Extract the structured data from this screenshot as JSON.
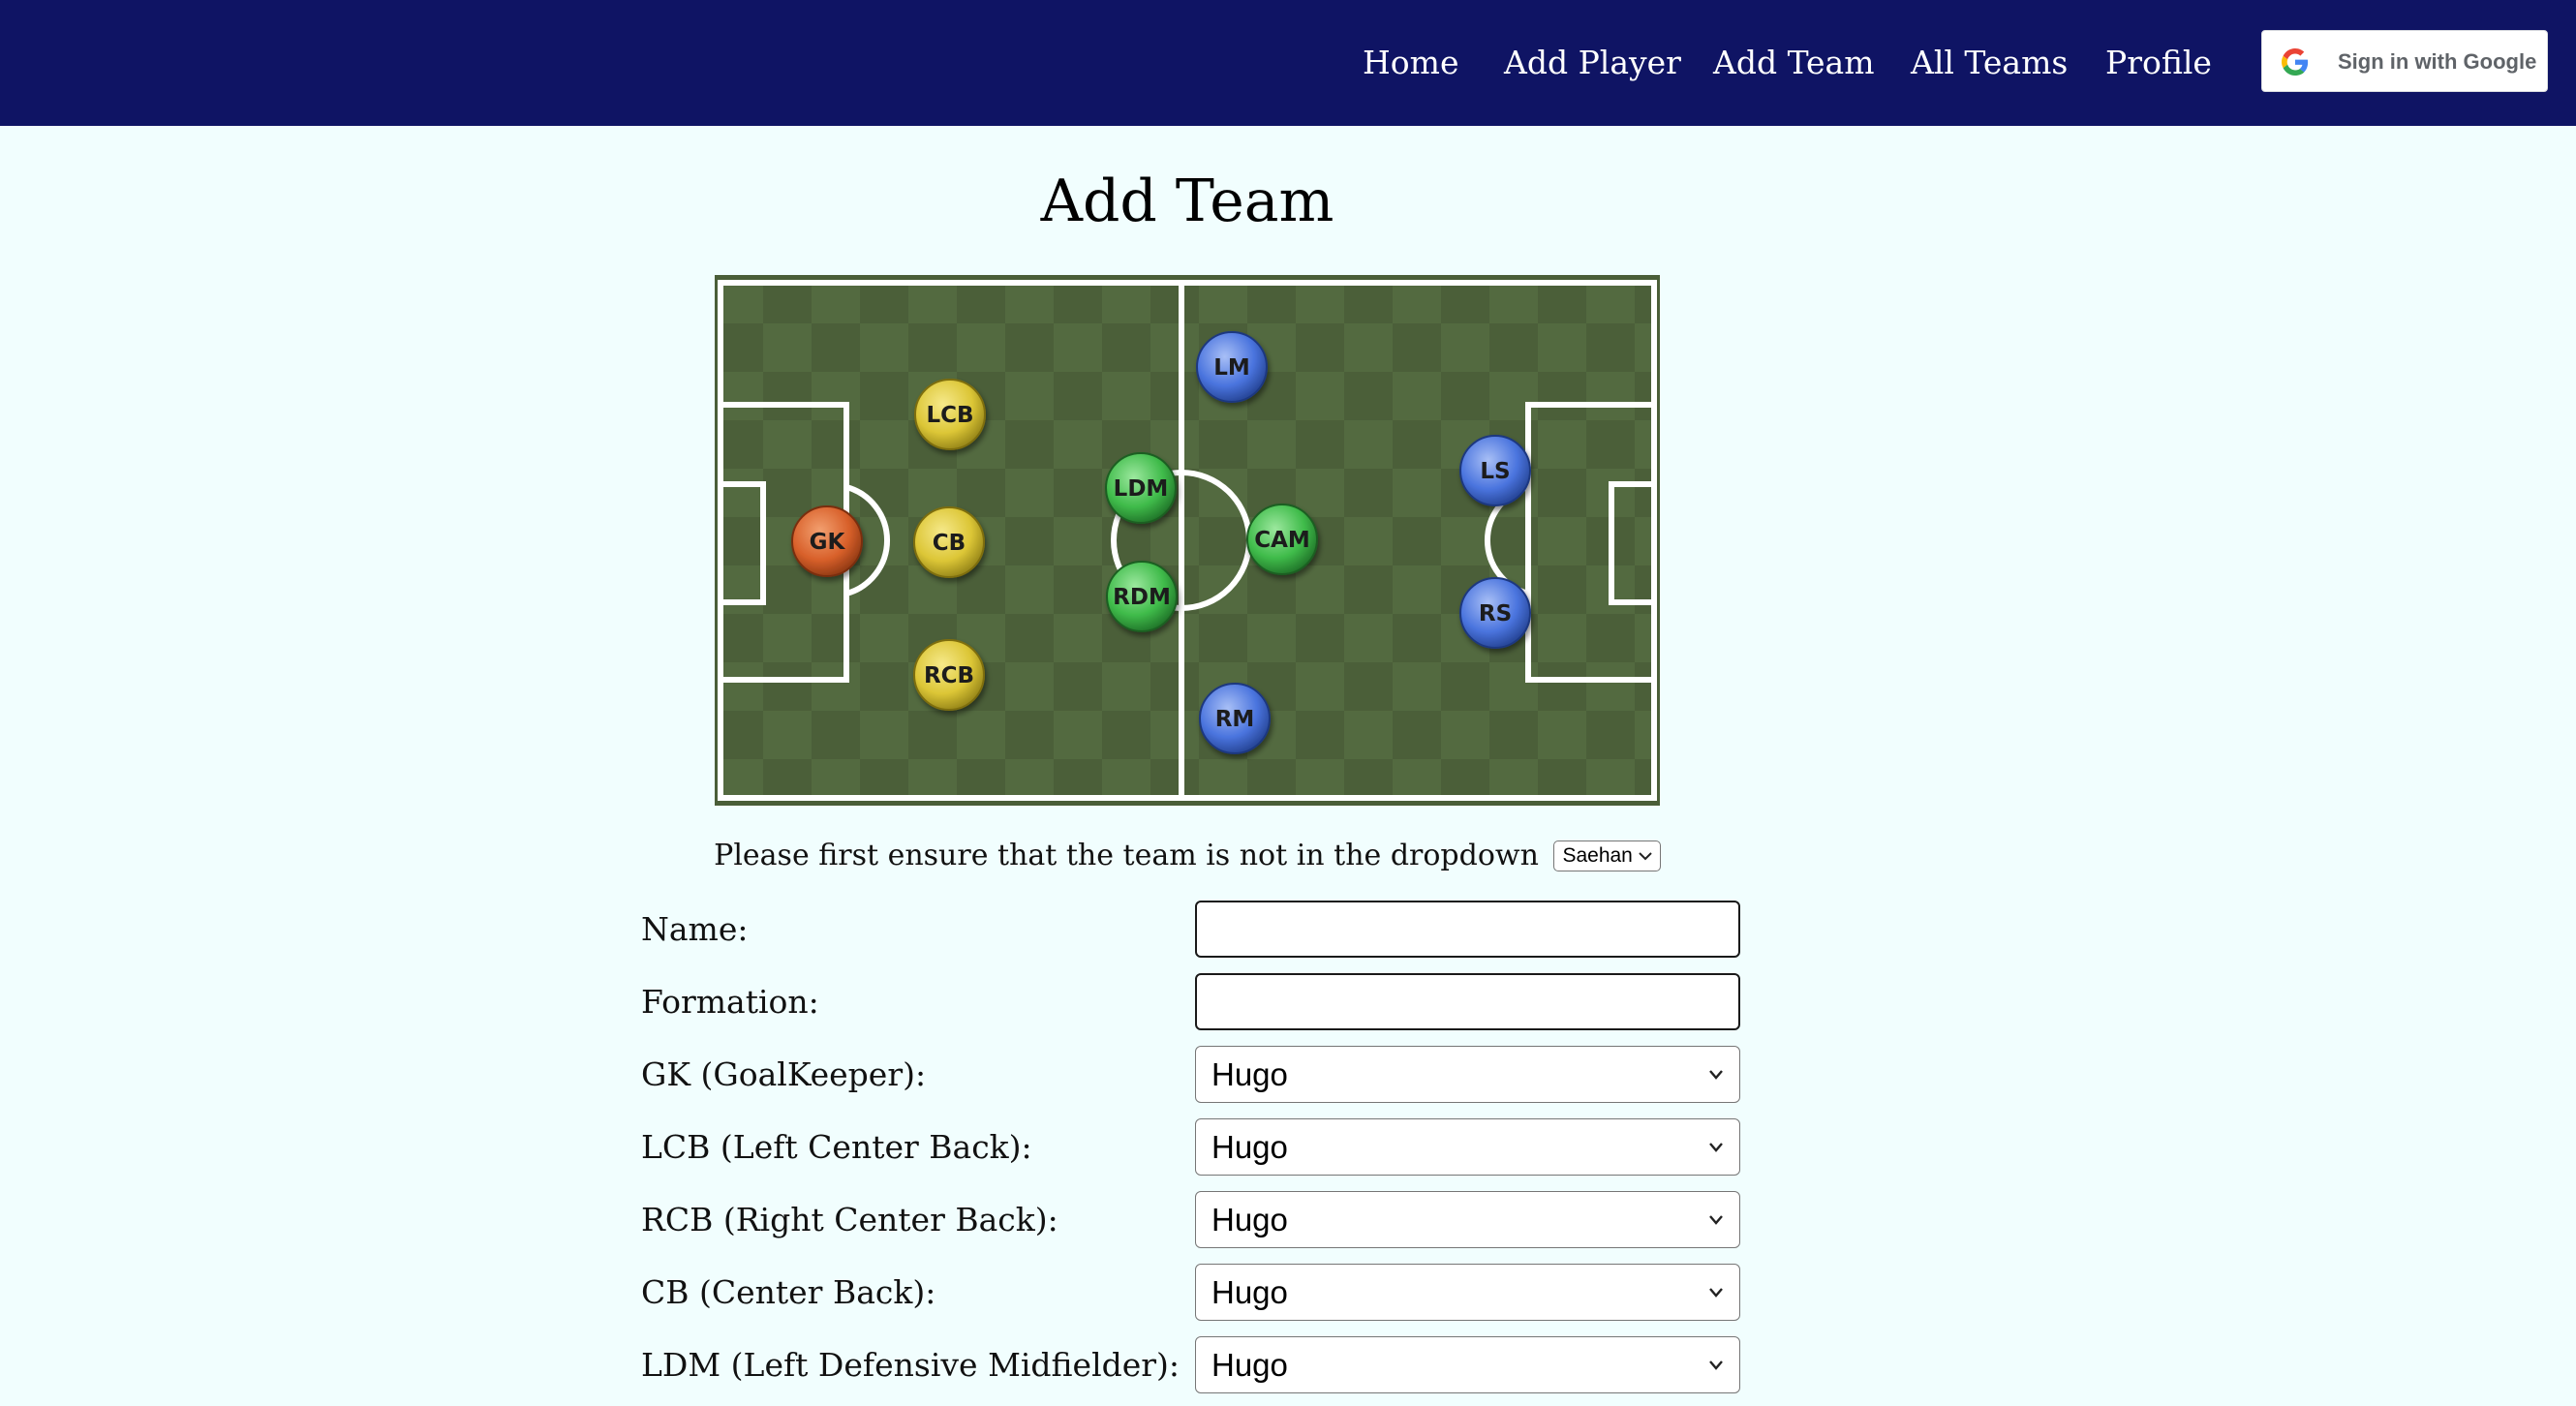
{
  "nav": {
    "links": [
      "Home",
      "Add Player",
      "Add Team",
      "All Teams",
      "Profile"
    ],
    "google_button_label": "Sign in with Google"
  },
  "page": {
    "title": "Add Team"
  },
  "pitch": {
    "positions": [
      {
        "label": "GK",
        "color": "orange"
      },
      {
        "label": "LCB",
        "color": "yellow"
      },
      {
        "label": "CB",
        "color": "yellow"
      },
      {
        "label": "RCB",
        "color": "yellow"
      },
      {
        "label": "LDM",
        "color": "green"
      },
      {
        "label": "RDM",
        "color": "green"
      },
      {
        "label": "CAM",
        "color": "green"
      },
      {
        "label": "LM",
        "color": "blue"
      },
      {
        "label": "RM",
        "color": "blue"
      },
      {
        "label": "LS",
        "color": "blue"
      },
      {
        "label": "RS",
        "color": "blue"
      }
    ]
  },
  "dropdown_note": {
    "text": "Please first ensure that the team is not in the dropdown",
    "selected_team": "Saehan"
  },
  "form": {
    "name_label": "Name:",
    "name_value": "",
    "formation_label": "Formation:",
    "formation_value": "",
    "selects": [
      {
        "label": "GK (GoalKeeper):",
        "value": "Hugo"
      },
      {
        "label": "LCB (Left Center Back):",
        "value": "Hugo"
      },
      {
        "label": "RCB (Right Center Back):",
        "value": "Hugo"
      },
      {
        "label": "CB (Center Back):",
        "value": "Hugo"
      },
      {
        "label": "LDM (Left Defensive Midfielder):",
        "value": "Hugo"
      }
    ]
  },
  "colors": {
    "navbar": "#0f1464",
    "background": "#f1fefe",
    "pitch_dark": "#4a5e38",
    "pitch_light": "#536a40",
    "orange": "#d8602a",
    "yellow": "#dcc636",
    "green": "#3fbb4a",
    "blue": "#4a74de"
  }
}
